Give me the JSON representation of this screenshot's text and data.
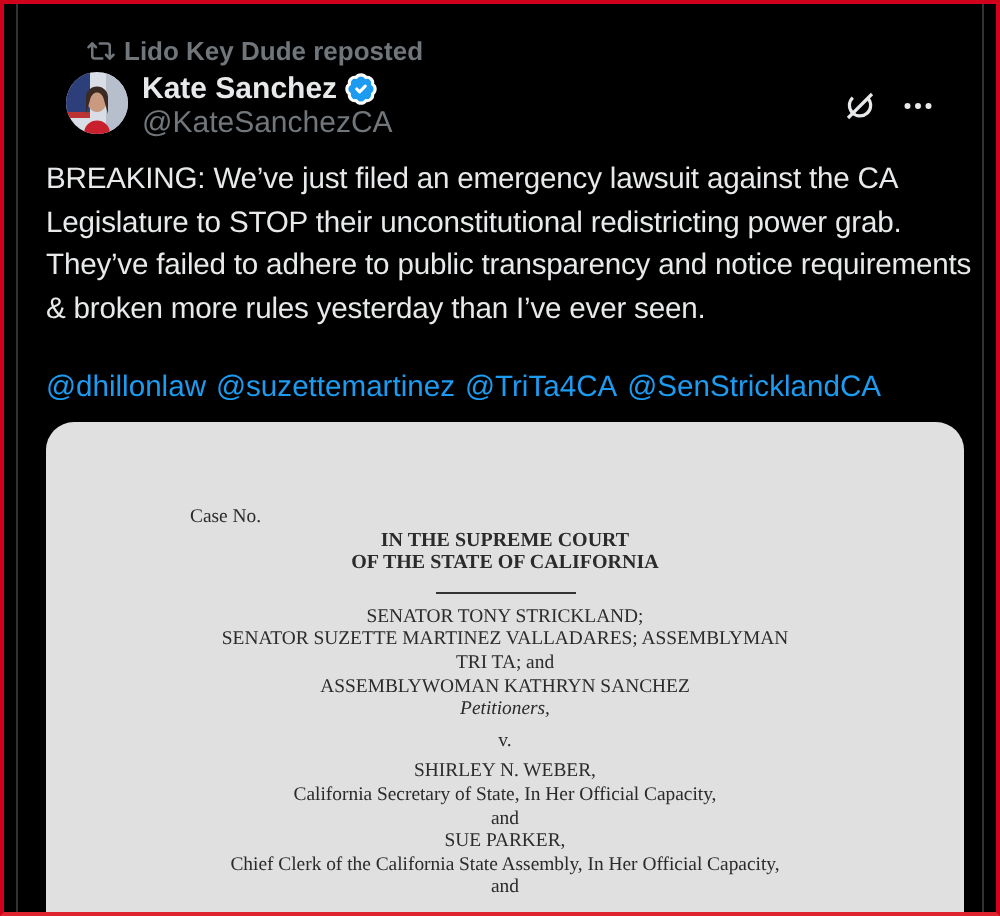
{
  "repost": {
    "text": "Lido Key Dude reposted"
  },
  "author": {
    "name": "Kate Sanchez",
    "verified": true,
    "handle": "@KateSanchezCA"
  },
  "post": {
    "text": "BREAKING: We’ve just filed an emergency lawsuit against the CA Legislature to STOP their unconstitutional redistricting power grab. They’ve failed to adhere to public transparency and notice requirements & broken more rules yesterday than I’ve ever seen.",
    "mentions": [
      "@dhillonlaw",
      "@suzettemartinez",
      "@TriTa4CA",
      "@SenStricklandCA"
    ]
  },
  "document": {
    "lines": [
      {
        "kind": "caption",
        "text": "Case No."
      },
      {
        "kind": "heading",
        "text": "IN THE SUPREME COURT"
      },
      {
        "kind": "heading",
        "text": "OF THE STATE OF CALIFORNIA"
      },
      {
        "kind": "rule"
      },
      {
        "kind": "plain",
        "text": "SENATOR TONY STRICKLAND;"
      },
      {
        "kind": "plain",
        "text": "SENATOR SUZETTE MARTINEZ VALLADARES; ASSEMBLYMAN"
      },
      {
        "kind": "plain",
        "text": "TRI TA; and"
      },
      {
        "kind": "plain",
        "text": "ASSEMBLYWOMAN KATHRYN SANCHEZ"
      },
      {
        "kind": "italic",
        "text": "Petitioners,"
      },
      {
        "kind": "separator",
        "text": "v."
      },
      {
        "kind": "plain",
        "text": "SHIRLEY N. WEBER,"
      },
      {
        "kind": "plain",
        "text": "California Secretary of State, In Her Official Capacity,"
      },
      {
        "kind": "plain",
        "text": "and"
      },
      {
        "kind": "plain",
        "text": "SUE PARKER,"
      },
      {
        "kind": "plain",
        "text": "Chief Clerk of the California State Assembly, In Her Official Capacity,"
      },
      {
        "kind": "plain",
        "text": "and"
      }
    ]
  }
}
